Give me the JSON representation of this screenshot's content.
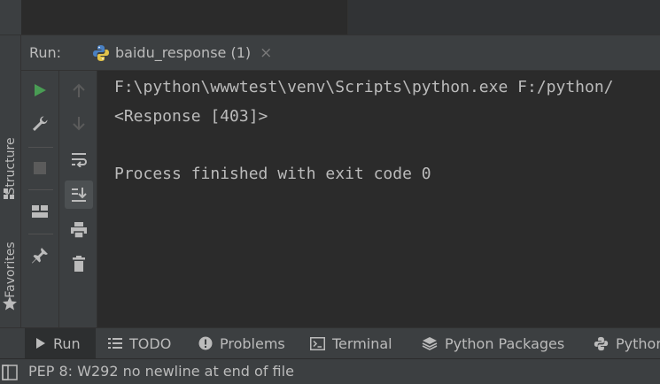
{
  "run_panel": {
    "label": "Run:",
    "tab_label": "baidu_response (1)",
    "tab_close": "×"
  },
  "left_tool_strip": {
    "structure": "Structure",
    "favorites": "Favorites"
  },
  "console": {
    "lines": [
      "F:\\python\\wwwtest\\venv\\Scripts\\python.exe F:/python/",
      "<Response [403]>",
      "",
      "Process finished with exit code 0"
    ]
  },
  "bottom_tabs": [
    {
      "label": "Run",
      "icon": "play-icon"
    },
    {
      "label": "TODO",
      "icon": "list-icon"
    },
    {
      "label": "Problems",
      "icon": "alert-circle-icon"
    },
    {
      "label": "Terminal",
      "icon": "terminal-icon"
    },
    {
      "label": "Python Packages",
      "icon": "layers-icon"
    },
    {
      "label": "Python",
      "icon": "python-icon"
    }
  ],
  "status_bar": {
    "message": "PEP 8: W292 no newline at end of file"
  },
  "colors": {
    "run_green": "#499c54",
    "panel": "#3c3f41",
    "editor": "#2b2b2b",
    "text": "#bbbbbb"
  }
}
